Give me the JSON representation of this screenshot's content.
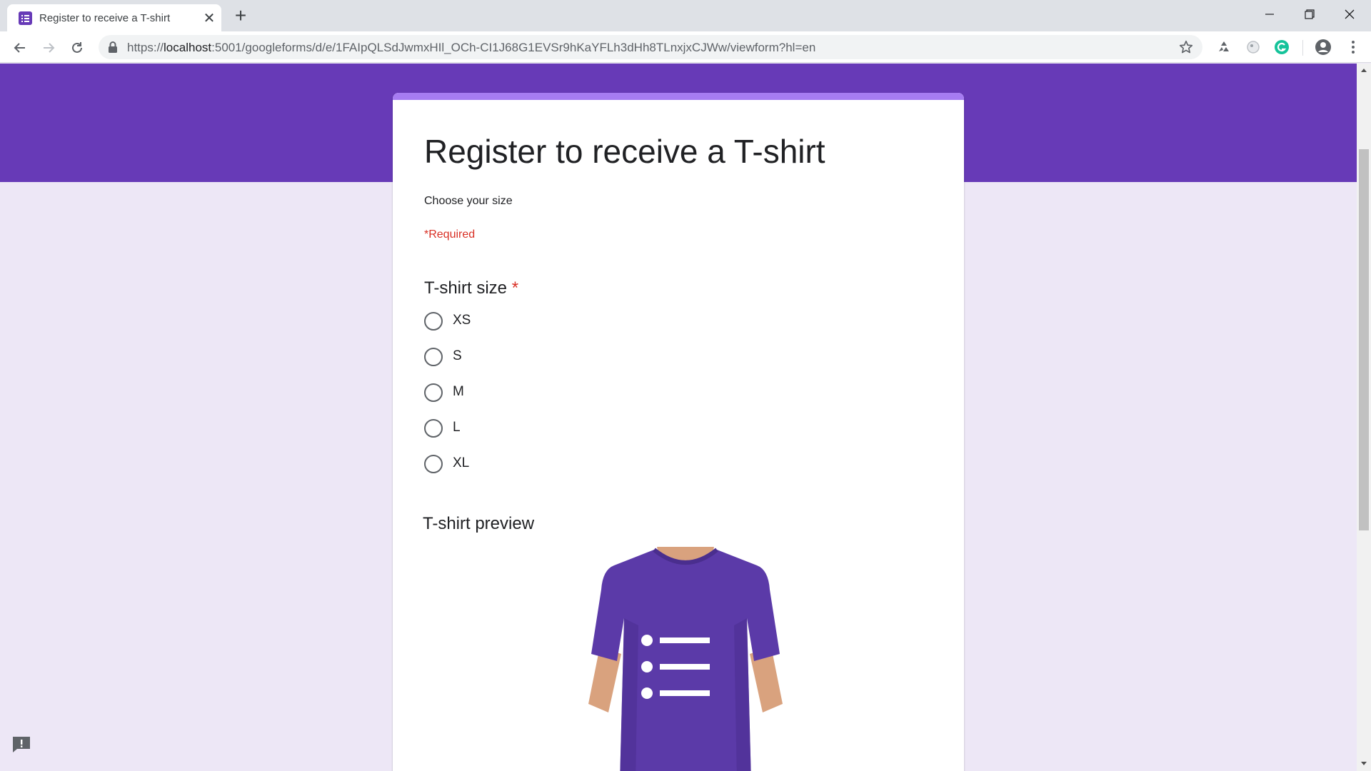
{
  "browser": {
    "tab_title": "Register to receive a T-shirt",
    "tab_close_glyph": "✕",
    "new_tab_glyph": "+",
    "url_scheme": "https://",
    "url_host": "localhost",
    "url_rest": ":5001/googleforms/d/e/1FAIpQLSdJwmxHIl_OCh-CI1J68G1EVSr9hKaYFLh3dHh8TLnxjxCJWw/viewform?hl=en",
    "icons": [
      "form-favicon-icon",
      "back-icon",
      "forward-icon",
      "reload-icon",
      "lock-icon",
      "star-icon",
      "recycle-extension-icon",
      "extension-icon",
      "grammarly-icon",
      "profile-icon",
      "menu-dots-icon",
      "minimize-icon",
      "restore-icon",
      "close-window-icon"
    ]
  },
  "form": {
    "title": "Register to receive a T-shirt",
    "description": "Choose your size",
    "required_note": "*Required",
    "question": {
      "title": "T-shirt size",
      "required_mark": "*",
      "options": [
        "XS",
        "S",
        "M",
        "L",
        "XL"
      ]
    },
    "preview_title": "T-shirt preview"
  },
  "colors": {
    "theme": "#673ab7",
    "accent": "#a67cf2",
    "background": "#ede7f6",
    "required": "#d93025"
  },
  "icons": {
    "feedback": "feedback-icon",
    "tshirt_image": "tshirt-image"
  }
}
